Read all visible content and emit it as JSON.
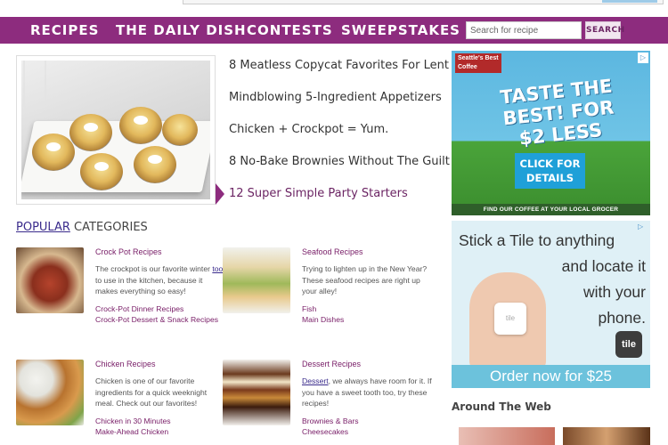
{
  "nav": {
    "items": [
      "RECIPES",
      "THE DAILY DISH",
      "CONTESTS",
      "SWEEPSTAKES"
    ],
    "search_placeholder": "Search for recipe",
    "search_button": "SEARCH"
  },
  "featured": {
    "links": [
      "8 Meatless Copycat Favorites For Lent",
      "Mindblowing 5-Ingredient Appetizers",
      "Chicken + Crockpot = Yum.",
      "8 No-Bake Brownies Without The Guilt",
      "12 Super Simple Party Starters"
    ],
    "active_index": 4
  },
  "popular": {
    "word": "POPULAR",
    "rest": " CATEGORIES",
    "categories": [
      {
        "title": "Crock Pot Recipes",
        "desc_before": "The crockpot is our favorite winter ",
        "desc_link": "tool",
        "desc_after": " to use in the kitchen, because it makes everything so easy!",
        "links": [
          "Crock-Pot Dinner Recipes",
          "Crock-Pot Dessert & Snack Recipes"
        ]
      },
      {
        "title": "Seafood Recipes",
        "desc_before": "Trying to lighten up in the New Year? These seafood recipes are right up your alley!",
        "desc_link": "",
        "desc_after": "",
        "links": [
          "Fish",
          "Main Dishes"
        ]
      },
      {
        "title": "Chicken Recipes",
        "desc_before": "Chicken is one of our favorite ingredients for a quick weeknight meal. Check out our favorites!",
        "desc_link": "",
        "desc_after": "",
        "links": [
          "Chicken in 30 Minutes",
          "Make-Ahead Chicken"
        ]
      },
      {
        "title": "Dessert Recipes",
        "desc_before": "",
        "desc_link": "Dessert",
        "desc_after": ", we always have room for it. If you have a sweet tooth too, try these recipes!",
        "links": [
          "Brownies & Bars",
          "Cheesecakes"
        ]
      }
    ]
  },
  "ads": {
    "coffee": {
      "brand_line1": "Seattle's Best",
      "brand_line2": "Coffee",
      "headline": "TASTE THE BEST! FOR $2 LESS",
      "cta": "CLICK FOR DETAILS",
      "footer": "FIND OUR COFFEE AT YOUR LOCAL GROCER"
    },
    "tile": {
      "line1": "Stick a Tile to anything",
      "line2": "and locate it",
      "line3": "with your",
      "line4": "phone.",
      "device_text": "tile",
      "logo": "tile",
      "cta": "Order now for $25"
    }
  },
  "around_title": "Around The Web"
}
